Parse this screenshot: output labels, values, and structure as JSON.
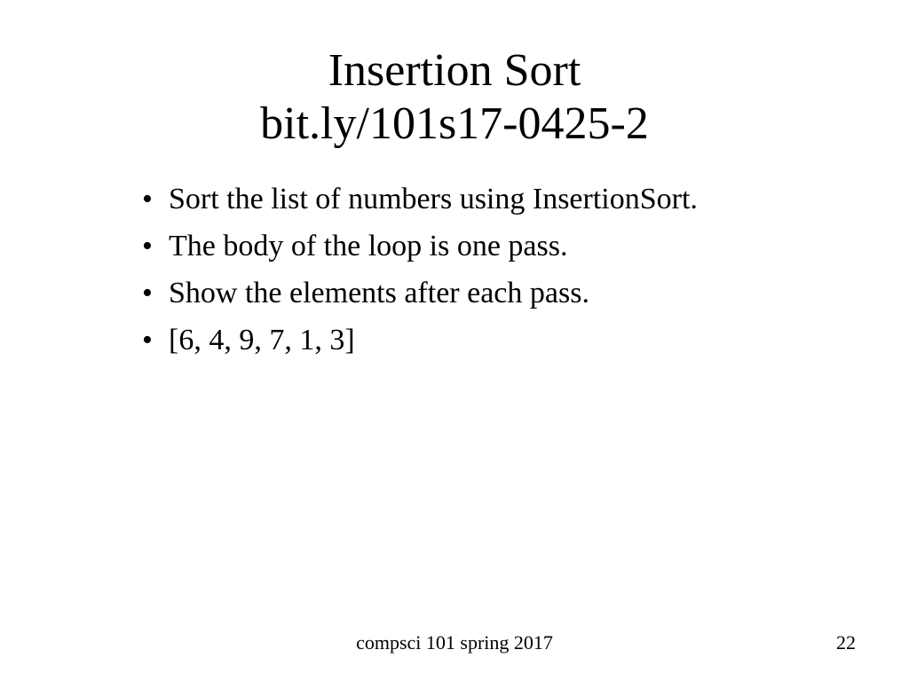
{
  "title": {
    "line1": "Insertion Sort",
    "line2": "bit.ly/101s17-0425-2"
  },
  "bullets": [
    "Sort the list of numbers using InsertionSort.",
    "The body of the loop is one pass.",
    "Show the elements after each pass.",
    "[6, 4, 9, 7, 1, 3]"
  ],
  "footer": {
    "course": "compsci 101 spring 2017",
    "page": "22"
  }
}
